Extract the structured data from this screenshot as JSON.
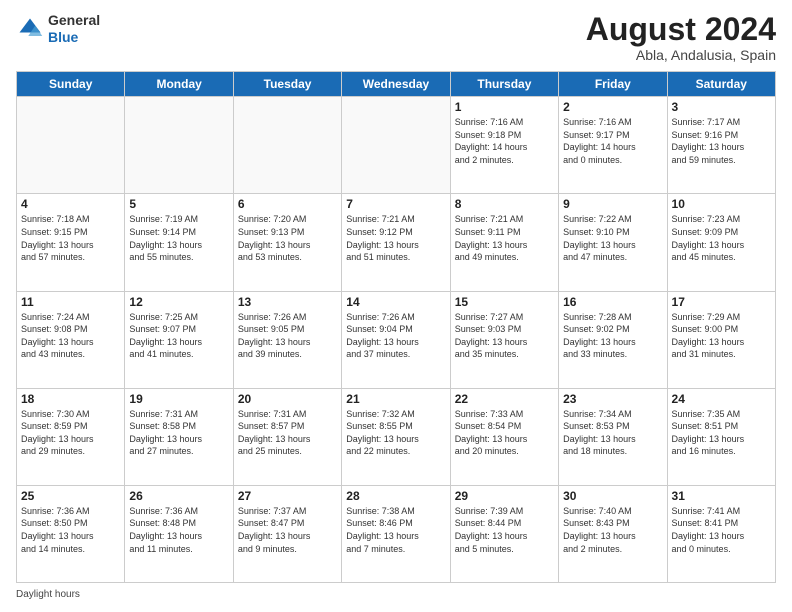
{
  "logo": {
    "general": "General",
    "blue": "Blue"
  },
  "title": "August 2024",
  "subtitle": "Abla, Andalusia, Spain",
  "days_header": [
    "Sunday",
    "Monday",
    "Tuesday",
    "Wednesday",
    "Thursday",
    "Friday",
    "Saturday"
  ],
  "weeks": [
    [
      {
        "day": "",
        "info": ""
      },
      {
        "day": "",
        "info": ""
      },
      {
        "day": "",
        "info": ""
      },
      {
        "day": "",
        "info": ""
      },
      {
        "day": "1",
        "info": "Sunrise: 7:16 AM\nSunset: 9:18 PM\nDaylight: 14 hours\nand 2 minutes."
      },
      {
        "day": "2",
        "info": "Sunrise: 7:16 AM\nSunset: 9:17 PM\nDaylight: 14 hours\nand 0 minutes."
      },
      {
        "day": "3",
        "info": "Sunrise: 7:17 AM\nSunset: 9:16 PM\nDaylight: 13 hours\nand 59 minutes."
      }
    ],
    [
      {
        "day": "4",
        "info": "Sunrise: 7:18 AM\nSunset: 9:15 PM\nDaylight: 13 hours\nand 57 minutes."
      },
      {
        "day": "5",
        "info": "Sunrise: 7:19 AM\nSunset: 9:14 PM\nDaylight: 13 hours\nand 55 minutes."
      },
      {
        "day": "6",
        "info": "Sunrise: 7:20 AM\nSunset: 9:13 PM\nDaylight: 13 hours\nand 53 minutes."
      },
      {
        "day": "7",
        "info": "Sunrise: 7:21 AM\nSunset: 9:12 PM\nDaylight: 13 hours\nand 51 minutes."
      },
      {
        "day": "8",
        "info": "Sunrise: 7:21 AM\nSunset: 9:11 PM\nDaylight: 13 hours\nand 49 minutes."
      },
      {
        "day": "9",
        "info": "Sunrise: 7:22 AM\nSunset: 9:10 PM\nDaylight: 13 hours\nand 47 minutes."
      },
      {
        "day": "10",
        "info": "Sunrise: 7:23 AM\nSunset: 9:09 PM\nDaylight: 13 hours\nand 45 minutes."
      }
    ],
    [
      {
        "day": "11",
        "info": "Sunrise: 7:24 AM\nSunset: 9:08 PM\nDaylight: 13 hours\nand 43 minutes."
      },
      {
        "day": "12",
        "info": "Sunrise: 7:25 AM\nSunset: 9:07 PM\nDaylight: 13 hours\nand 41 minutes."
      },
      {
        "day": "13",
        "info": "Sunrise: 7:26 AM\nSunset: 9:05 PM\nDaylight: 13 hours\nand 39 minutes."
      },
      {
        "day": "14",
        "info": "Sunrise: 7:26 AM\nSunset: 9:04 PM\nDaylight: 13 hours\nand 37 minutes."
      },
      {
        "day": "15",
        "info": "Sunrise: 7:27 AM\nSunset: 9:03 PM\nDaylight: 13 hours\nand 35 minutes."
      },
      {
        "day": "16",
        "info": "Sunrise: 7:28 AM\nSunset: 9:02 PM\nDaylight: 13 hours\nand 33 minutes."
      },
      {
        "day": "17",
        "info": "Sunrise: 7:29 AM\nSunset: 9:00 PM\nDaylight: 13 hours\nand 31 minutes."
      }
    ],
    [
      {
        "day": "18",
        "info": "Sunrise: 7:30 AM\nSunset: 8:59 PM\nDaylight: 13 hours\nand 29 minutes."
      },
      {
        "day": "19",
        "info": "Sunrise: 7:31 AM\nSunset: 8:58 PM\nDaylight: 13 hours\nand 27 minutes."
      },
      {
        "day": "20",
        "info": "Sunrise: 7:31 AM\nSunset: 8:57 PM\nDaylight: 13 hours\nand 25 minutes."
      },
      {
        "day": "21",
        "info": "Sunrise: 7:32 AM\nSunset: 8:55 PM\nDaylight: 13 hours\nand 22 minutes."
      },
      {
        "day": "22",
        "info": "Sunrise: 7:33 AM\nSunset: 8:54 PM\nDaylight: 13 hours\nand 20 minutes."
      },
      {
        "day": "23",
        "info": "Sunrise: 7:34 AM\nSunset: 8:53 PM\nDaylight: 13 hours\nand 18 minutes."
      },
      {
        "day": "24",
        "info": "Sunrise: 7:35 AM\nSunset: 8:51 PM\nDaylight: 13 hours\nand 16 minutes."
      }
    ],
    [
      {
        "day": "25",
        "info": "Sunrise: 7:36 AM\nSunset: 8:50 PM\nDaylight: 13 hours\nand 14 minutes."
      },
      {
        "day": "26",
        "info": "Sunrise: 7:36 AM\nSunset: 8:48 PM\nDaylight: 13 hours\nand 11 minutes."
      },
      {
        "day": "27",
        "info": "Sunrise: 7:37 AM\nSunset: 8:47 PM\nDaylight: 13 hours\nand 9 minutes."
      },
      {
        "day": "28",
        "info": "Sunrise: 7:38 AM\nSunset: 8:46 PM\nDaylight: 13 hours\nand 7 minutes."
      },
      {
        "day": "29",
        "info": "Sunrise: 7:39 AM\nSunset: 8:44 PM\nDaylight: 13 hours\nand 5 minutes."
      },
      {
        "day": "30",
        "info": "Sunrise: 7:40 AM\nSunset: 8:43 PM\nDaylight: 13 hours\nand 2 minutes."
      },
      {
        "day": "31",
        "info": "Sunrise: 7:41 AM\nSunset: 8:41 PM\nDaylight: 13 hours\nand 0 minutes."
      }
    ]
  ],
  "legend": "Daylight hours"
}
